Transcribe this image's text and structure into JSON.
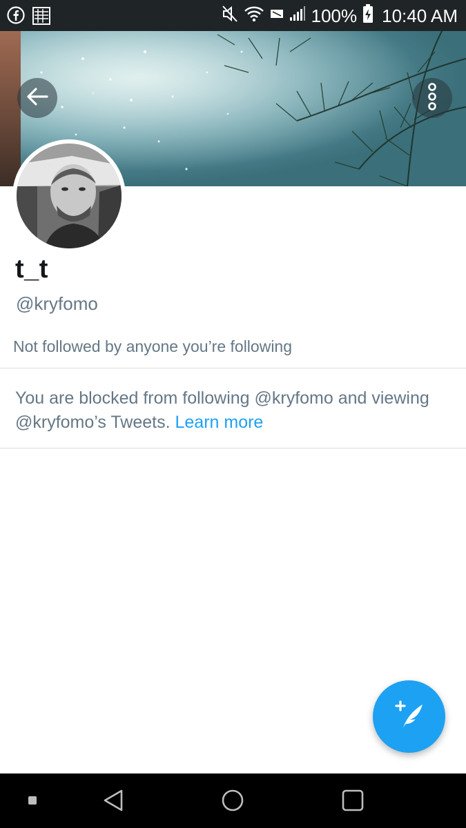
{
  "status_bar": {
    "battery_percent": "100%",
    "time": "10:40 AM",
    "icons": [
      "facebook-icon",
      "notification-icon",
      "mute-icon",
      "wifi-icon",
      "no-sim-icon",
      "signal-icon",
      "battery-charging-icon"
    ]
  },
  "header": {
    "back_icon": "arrow-left-icon",
    "more_icon": "more-vertical-icon"
  },
  "profile": {
    "display_name": "t_t",
    "handle": "@kryfomo",
    "followed_by": "Not followed by anyone you’re following"
  },
  "blocked_notice": {
    "text": "You are blocked from following @kryfomo and viewing @kryfomo’s Tweets.",
    "link": "Learn more"
  },
  "fab": {
    "icon": "compose-tweet-icon"
  },
  "nav_bar": {
    "icons": [
      "recent-indicator-icon",
      "back-triangle-icon",
      "home-circle-icon",
      "overview-square-icon"
    ]
  },
  "colors": {
    "accent": "#1da1f2",
    "secondary_text": "#657786",
    "status_bar": "#1f2426"
  }
}
